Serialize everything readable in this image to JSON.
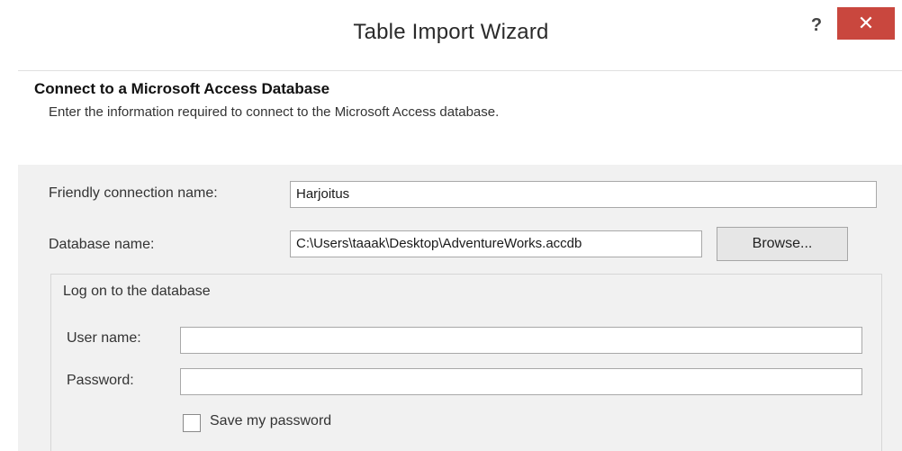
{
  "window": {
    "title": "Table Import Wizard",
    "help_label": "?",
    "close_label": "✕"
  },
  "header": {
    "title": "Connect to a Microsoft Access Database",
    "description": "Enter the information required to connect to the Microsoft Access database."
  },
  "form": {
    "friendly_name_label": "Friendly connection name:",
    "friendly_name_value": "Harjoitus",
    "database_name_label": "Database name:",
    "database_name_value": "C:\\Users\\taaak\\Desktop\\AdventureWorks.accdb",
    "browse_label": "Browse..."
  },
  "logon": {
    "group_label": "Log on to the database",
    "user_name_label": "User name:",
    "user_name_value": "",
    "password_label": "Password:",
    "password_value": "",
    "save_password_label": "Save my password",
    "save_password_checked": false
  },
  "colors": {
    "close_button": "#c9473e",
    "body_background": "#f1f1f1",
    "header_background": "#ffffff"
  }
}
